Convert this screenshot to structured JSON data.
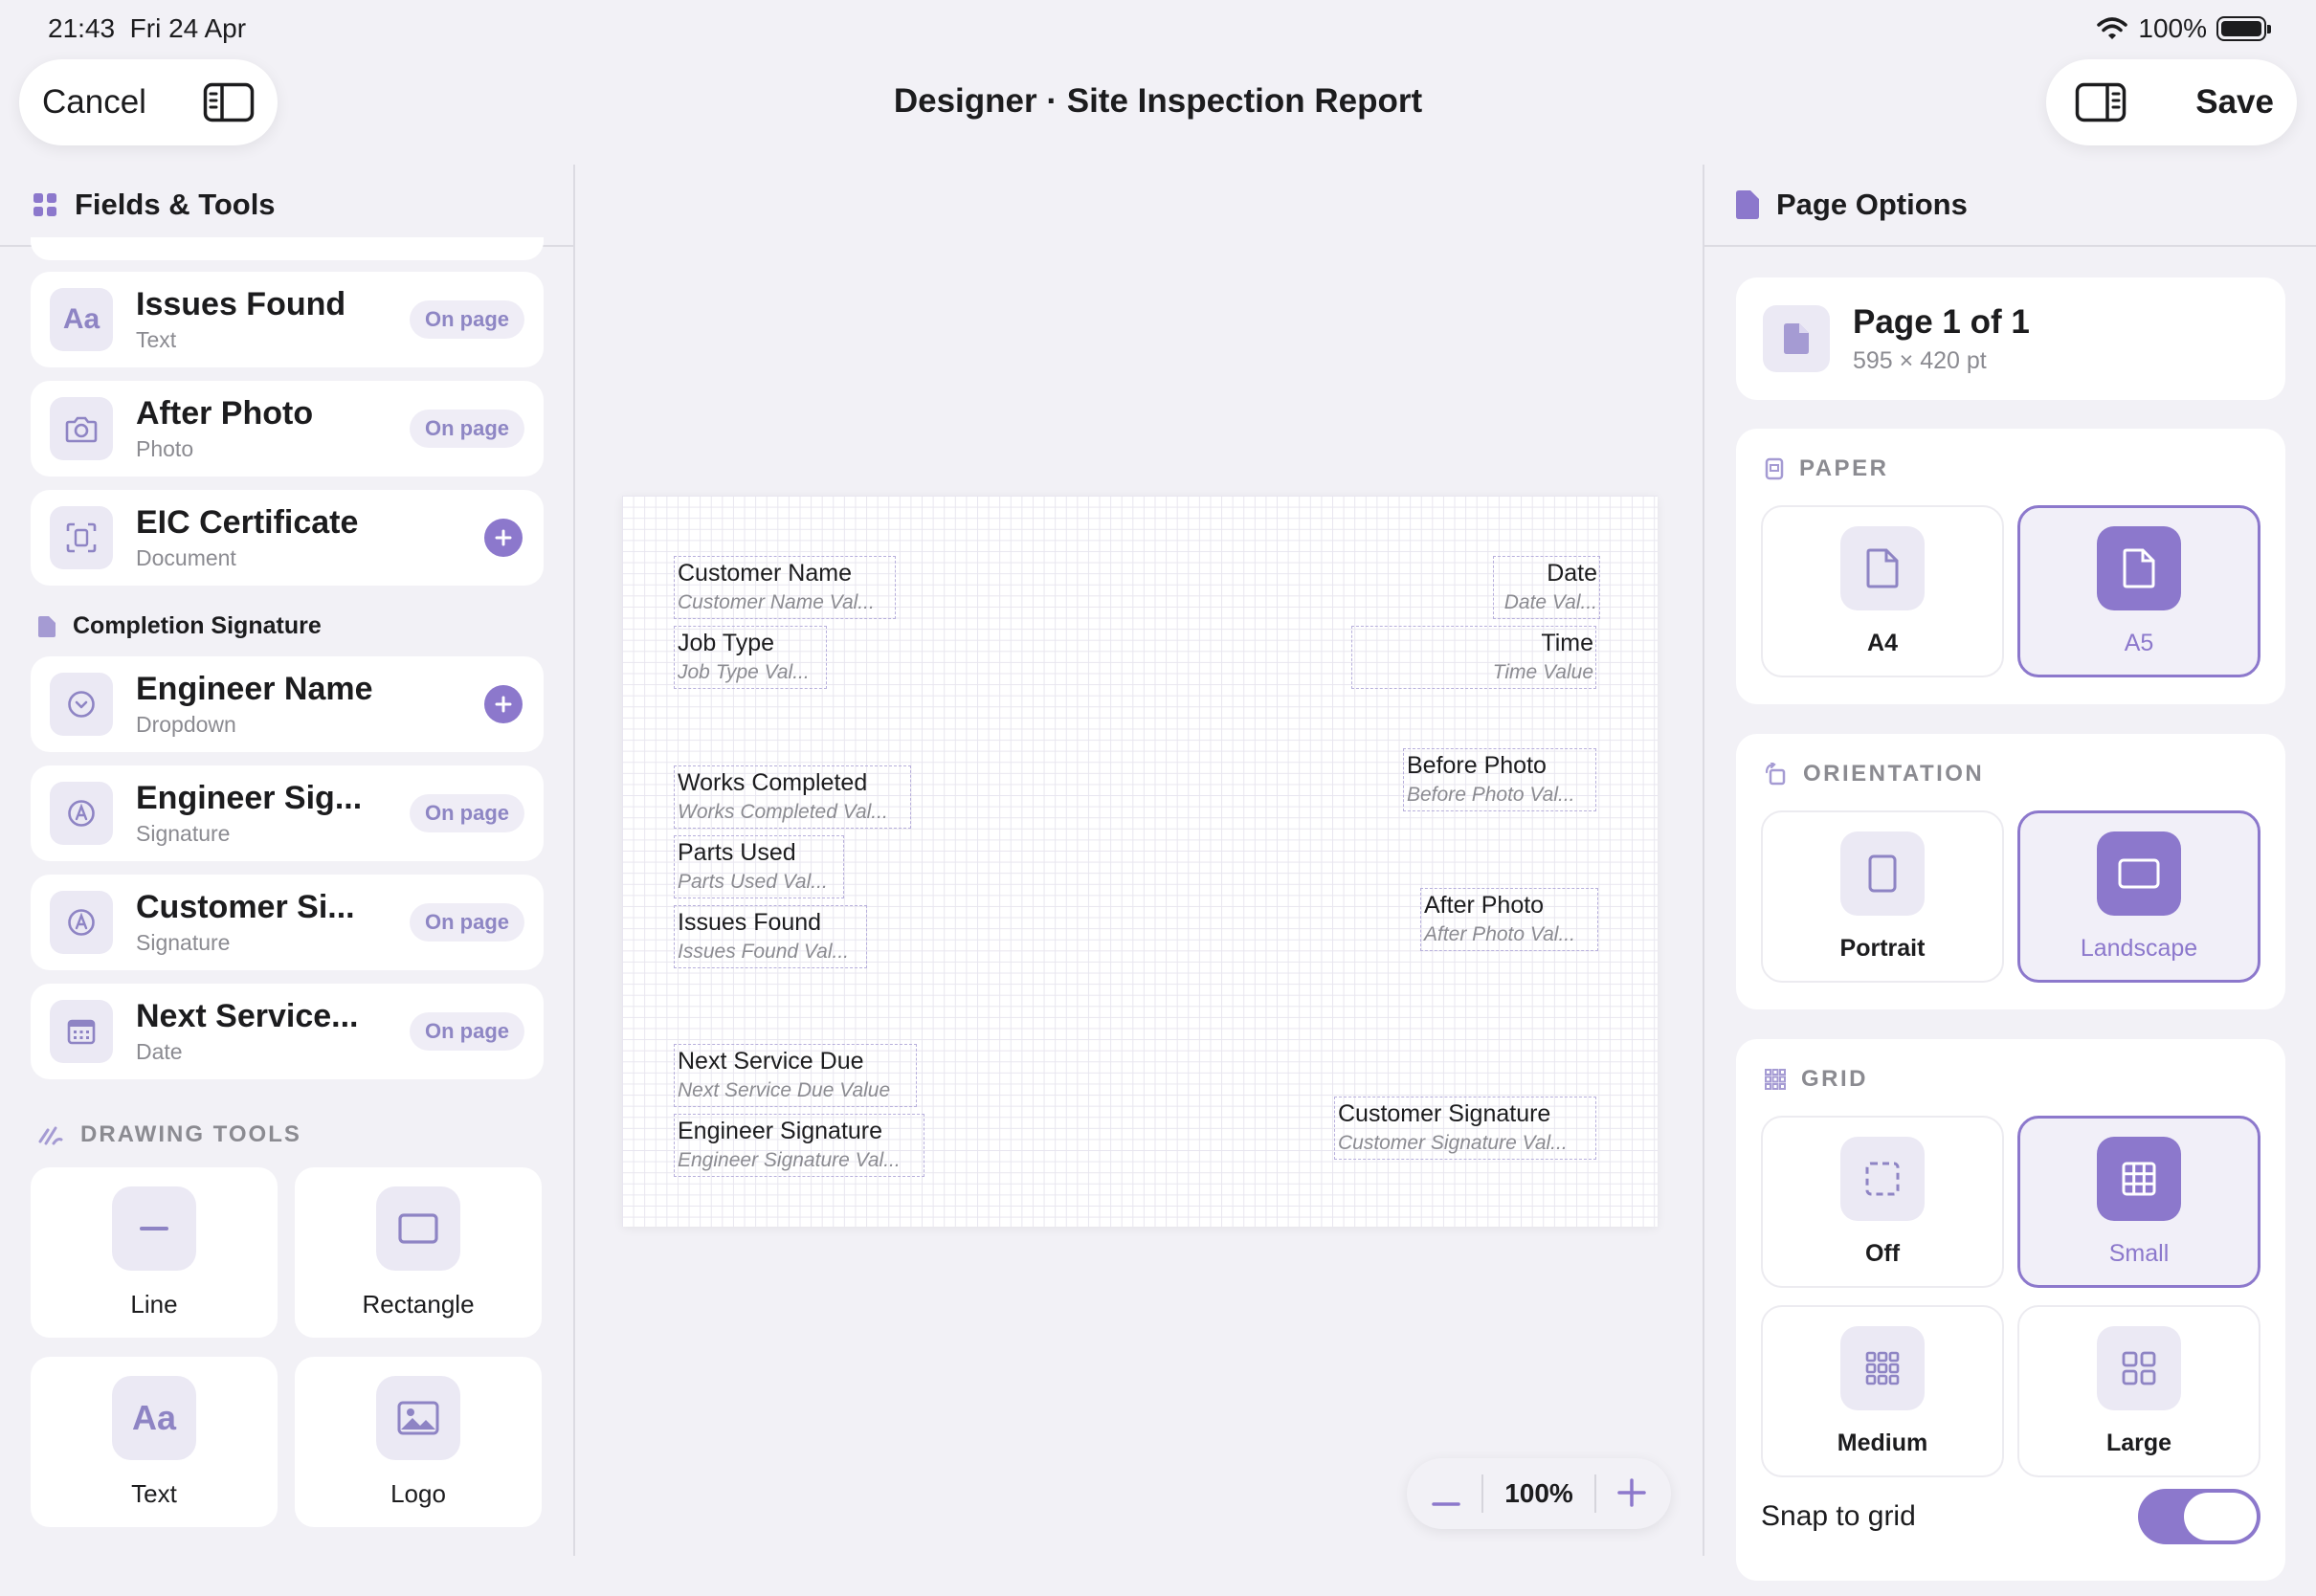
{
  "status_bar": {
    "time": "21:43",
    "date": "Fri 24 Apr",
    "battery": "100%"
  },
  "toolbar": {
    "cancel_label": "Cancel",
    "title": "Designer · Site Inspection Report",
    "save_label": "Save"
  },
  "left_panel": {
    "title": "Fields & Tools",
    "fields_top": [
      {
        "title": "Issues Found",
        "type": "Text",
        "status": "On page",
        "icon": "text-icon"
      },
      {
        "title": "After Photo",
        "type": "Photo",
        "status": "On page",
        "icon": "camera-icon"
      },
      {
        "title": "EIC Certificate",
        "type": "Document",
        "status": "add",
        "icon": "document-scan-icon"
      }
    ],
    "section_completion": "Completion Signature",
    "fields_bottom": [
      {
        "title": "Engineer Name",
        "type": "Dropdown",
        "status": "add",
        "icon": "chevron-circle-icon"
      },
      {
        "title": "Engineer Sig...",
        "type": "Signature",
        "status": "On page",
        "icon": "signature-icon"
      },
      {
        "title": "Customer Si...",
        "type": "Signature",
        "status": "On page",
        "icon": "signature-icon"
      },
      {
        "title": "Next Service...",
        "type": "Date",
        "status": "On page",
        "icon": "calendar-icon"
      }
    ],
    "drawing_tools_label": "DRAWING TOOLS",
    "tools": [
      {
        "label": "Line",
        "icon": "line-icon"
      },
      {
        "label": "Rectangle",
        "icon": "rectangle-icon"
      },
      {
        "label": "Text",
        "icon": "text-icon",
        "glyph": "Aa"
      },
      {
        "label": "Logo",
        "icon": "image-icon"
      }
    ]
  },
  "canvas": {
    "elements": [
      {
        "label": "Customer Name",
        "value": "Customer Name Val..."
      },
      {
        "label": "Date",
        "value": "Date Val..."
      },
      {
        "label": "Job Type",
        "value": "Job Type Val..."
      },
      {
        "label": "Time",
        "value": "Time Value"
      },
      {
        "label": "Works Completed",
        "value": "Works Completed Val..."
      },
      {
        "label": "Before Photo",
        "value": "Before Photo Val..."
      },
      {
        "label": "Parts Used",
        "value": "Parts Used Val..."
      },
      {
        "label": "Issues Found",
        "value": "Issues Found Val..."
      },
      {
        "label": "After Photo",
        "value": "After Photo Val..."
      },
      {
        "label": "Next Service Due",
        "value": "Next Service Due Value"
      },
      {
        "label": "Engineer Signature",
        "value": "Engineer Signature Val..."
      },
      {
        "label": "Customer Signature",
        "value": "Customer Signature Val..."
      }
    ],
    "zoom": "100%"
  },
  "right_panel": {
    "title": "Page Options",
    "page_info": {
      "title": "Page 1 of 1",
      "size": "595 × 420 pt"
    },
    "paper": {
      "label": "PAPER",
      "options": [
        "A4",
        "A5"
      ],
      "selected": "A5"
    },
    "orientation": {
      "label": "ORIENTATION",
      "options": [
        "Portrait",
        "Landscape"
      ],
      "selected": "Landscape"
    },
    "grid": {
      "label": "GRID",
      "options": [
        "Off",
        "Small",
        "Medium",
        "Large"
      ],
      "selected": "Small"
    },
    "snap_label": "Snap to grid",
    "snap_on": true
  },
  "colors": {
    "accent": "#8c78cc",
    "accent_light": "#ebe9f4",
    "background": "#f2f1f6"
  }
}
